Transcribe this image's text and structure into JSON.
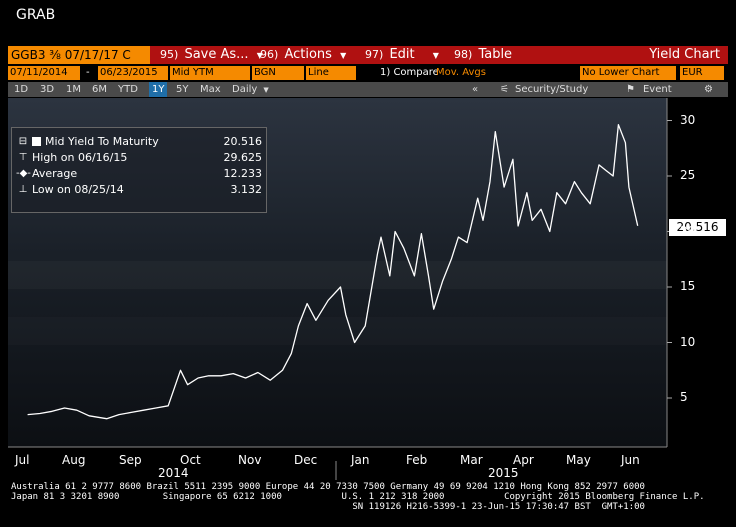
{
  "window": {
    "title": "GRAB"
  },
  "command_bar": {
    "ticker": "GGB3 ⅜ 07/17/17 C",
    "items": [
      {
        "num": "95)",
        "label": "Save As..."
      },
      {
        "num": "96)",
        "label": "Actions"
      },
      {
        "num": "97)",
        "label": "Edit"
      },
      {
        "num": "98)",
        "label": "Table"
      }
    ],
    "screen_name": "Yield Chart"
  },
  "params": {
    "start_date": "07/11/2014",
    "dash": "-",
    "end_date": "06/23/2015",
    "field": "Mid YTM",
    "source": "BGN",
    "style": "Line",
    "compare_label": "1) Compare",
    "compare_value": "Mov. Avgs",
    "lower_chart": "No Lower Chart",
    "currency": "EUR"
  },
  "toolbar": {
    "periods": [
      "1D",
      "3D",
      "1M",
      "6M",
      "YTD",
      "1Y",
      "5Y",
      "Max"
    ],
    "active_period": "1Y",
    "frequency": "Daily",
    "collapse": "«",
    "security_study": "Security/Study",
    "event": "Event"
  },
  "legend": {
    "series": {
      "label": "Mid Yield To Maturity",
      "value": "20.516"
    },
    "high": {
      "label": "High on 06/16/15",
      "value": "29.625"
    },
    "average": {
      "label": "Average",
      "value": "12.233"
    },
    "low": {
      "label": "Low on 08/25/14",
      "value": "3.132"
    }
  },
  "last_value": "20.516",
  "colors": {
    "accent": "#f58a00",
    "command_bar": "#b01111",
    "line": "#ffffff",
    "toolbar": "#4a4a4a"
  },
  "footer": {
    "line1": "Australia 61 2 9777 8600 Brazil 5511 2395 9000 Europe 44 20 7330 7500 Germany 49 69 9204 1210 Hong Kong 852 2977 6000",
    "line2": "Japan 81 3 3201 8900        Singapore 65 6212 1000           U.S. 1 212 318 2000           Copyright 2015 Bloomberg Finance L.P.",
    "line3": "                                                               SN 119126 H216-5399-1 23-Jun-15 17:30:47 BST  GMT+1:00"
  },
  "chart_data": {
    "type": "line",
    "title": "",
    "xlabel": "",
    "ylabel": "",
    "ylim": [
      0,
      32
    ],
    "yticks": [
      5,
      10,
      15,
      20,
      25,
      30
    ],
    "x_month_labels": [
      "Jul",
      "Aug",
      "Sep",
      "Oct",
      "Nov",
      "Dec",
      "Jan",
      "Feb",
      "Mar",
      "Apr",
      "May",
      "Jun"
    ],
    "x_year_labels": [
      "2014",
      "2015"
    ],
    "grid": false,
    "legend_position": "top-left",
    "series": [
      {
        "name": "Mid Yield To Maturity",
        "x": [
          "2014-07-11",
          "2014-07-18",
          "2014-07-25",
          "2014-08-01",
          "2014-08-08",
          "2014-08-15",
          "2014-08-25",
          "2014-09-01",
          "2014-09-08",
          "2014-09-15",
          "2014-09-22",
          "2014-09-29",
          "2014-10-06",
          "2014-10-10",
          "2014-10-16",
          "2014-10-22",
          "2014-10-29",
          "2014-11-05",
          "2014-11-12",
          "2014-11-19",
          "2014-11-26",
          "2014-12-03",
          "2014-12-08",
          "2014-12-12",
          "2014-12-17",
          "2014-12-22",
          "2014-12-29",
          "2015-01-05",
          "2015-01-08",
          "2015-01-13",
          "2015-01-19",
          "2015-01-26",
          "2015-01-28",
          "2015-02-02",
          "2015-02-05",
          "2015-02-10",
          "2015-02-16",
          "2015-02-20",
          "2015-02-24",
          "2015-02-27",
          "2015-03-04",
          "2015-03-09",
          "2015-03-13",
          "2015-03-18",
          "2015-03-24",
          "2015-03-27",
          "2015-03-31",
          "2015-04-03",
          "2015-04-08",
          "2015-04-13",
          "2015-04-16",
          "2015-04-21",
          "2015-04-24",
          "2015-04-29",
          "2015-05-04",
          "2015-05-08",
          "2015-05-13",
          "2015-05-18",
          "2015-05-22",
          "2015-05-27",
          "2015-06-01",
          "2015-06-05",
          "2015-06-09",
          "2015-06-12",
          "2015-06-16",
          "2015-06-18",
          "2015-06-23"
        ],
        "values": [
          3.5,
          3.6,
          3.8,
          4.1,
          3.9,
          3.4,
          3.132,
          3.5,
          3.7,
          3.9,
          4.1,
          4.3,
          7.5,
          6.2,
          6.8,
          7.0,
          7.0,
          7.2,
          6.8,
          7.3,
          6.6,
          7.5,
          9.0,
          11.5,
          13.5,
          12.0,
          13.8,
          15.0,
          12.5,
          10.0,
          11.5,
          18.0,
          19.5,
          16.0,
          20.0,
          18.5,
          16.0,
          19.8,
          16.0,
          13.0,
          15.5,
          17.5,
          19.5,
          19.0,
          23.0,
          21.0,
          24.5,
          29.0,
          24.0,
          26.5,
          20.5,
          23.5,
          21.0,
          22.0,
          20.0,
          23.5,
          22.5,
          24.5,
          23.5,
          22.5,
          26.0,
          25.5,
          25.0,
          29.625,
          28.0,
          24.0,
          20.516
        ]
      }
    ]
  }
}
